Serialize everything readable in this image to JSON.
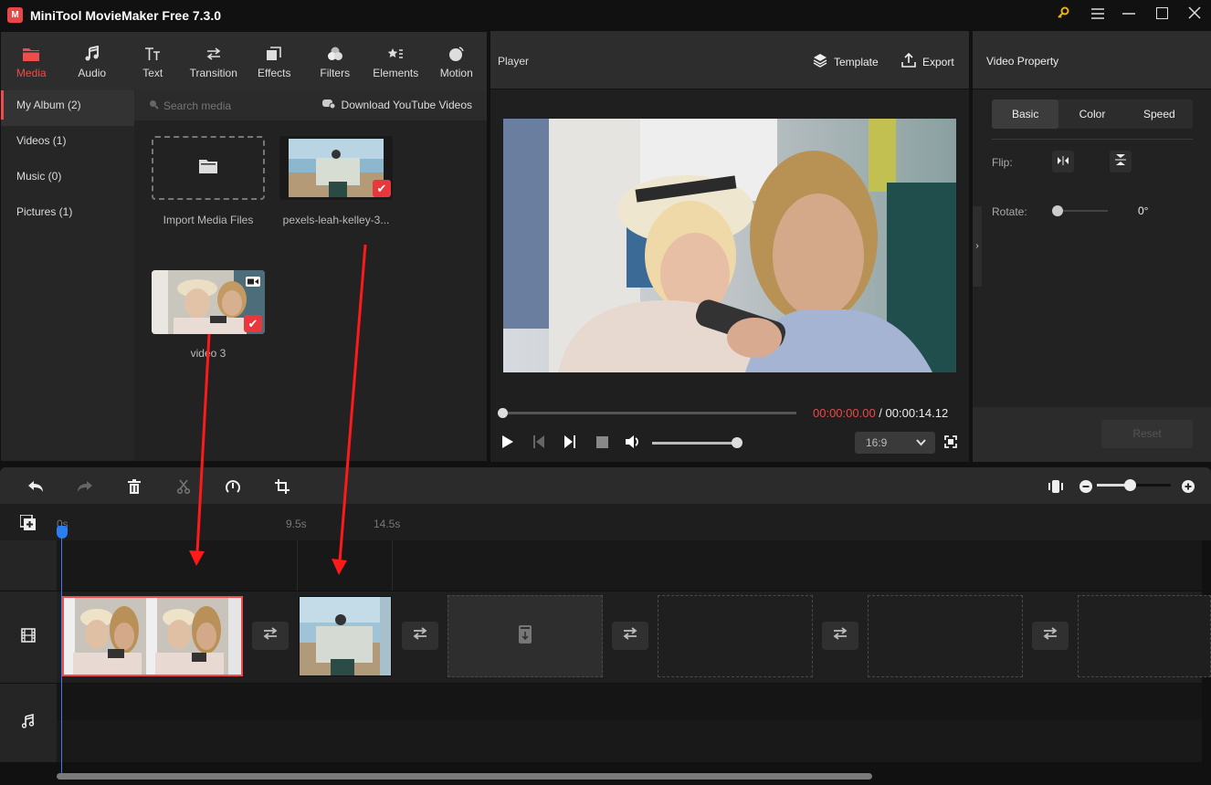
{
  "app": {
    "title": "MiniTool MovieMaker Free 7.3.0",
    "logo_glyph": "M",
    "window_controls": [
      {
        "name": "key-icon",
        "glyph": "🔑"
      },
      {
        "name": "menu-icon",
        "glyph": "☰"
      },
      {
        "name": "minimize-icon",
        "glyph": "—"
      },
      {
        "name": "maximize-icon",
        "glyph": "☐"
      },
      {
        "name": "close-icon",
        "glyph": "✕"
      }
    ]
  },
  "tool_tabs": [
    {
      "label": "Media",
      "icon": "folder-icon",
      "active": true
    },
    {
      "label": "Audio",
      "icon": "music-note-icon"
    },
    {
      "label": "Text",
      "icon": "text-icon"
    },
    {
      "label": "Transition",
      "icon": "transition-arrows-icon"
    },
    {
      "label": "Effects",
      "icon": "effects-icon"
    },
    {
      "label": "Filters",
      "icon": "filters-icon"
    },
    {
      "label": "Elements",
      "icon": "elements-icon"
    },
    {
      "label": "Motion",
      "icon": "motion-icon"
    }
  ],
  "album": {
    "items": [
      {
        "label": "My Album (2)",
        "active": true
      },
      {
        "label": "Videos (1)"
      },
      {
        "label": "Music (0)"
      },
      {
        "label": "Pictures (1)"
      }
    ]
  },
  "media": {
    "search_placeholder": "Search media",
    "youtube_label": "Download YouTube Videos",
    "import_label": "Import Media Files",
    "items": [
      {
        "label": "pexels-leah-kelley-3...",
        "type": "picture",
        "selected": true
      },
      {
        "label": "video 3",
        "type": "video",
        "selected": true
      }
    ]
  },
  "player": {
    "title": "Player",
    "template_label": "Template",
    "export_label": "Export",
    "time_current": "00:00:00.00",
    "time_separator": " / ",
    "time_total": "00:00:14.12",
    "progress": 0,
    "volume": 1.0,
    "aspect_ratio": "16:9"
  },
  "video_property": {
    "title": "Video Property",
    "tabs": [
      {
        "label": "Basic",
        "active": true
      },
      {
        "label": "Color"
      },
      {
        "label": "Speed"
      }
    ],
    "flip_label": "Flip:",
    "rotate_label": "Rotate:",
    "rotate_value": "0°",
    "reset_label": "Reset"
  },
  "timeline": {
    "ruler_labels": [
      "0s",
      "9.5s",
      "14.5s"
    ],
    "zoom_level": 0.45,
    "clips": [
      {
        "name": "video 3",
        "type": "video"
      },
      {
        "name": "pexels-leah-kelley",
        "type": "picture"
      }
    ],
    "empty_slot_count": 4
  },
  "colors": {
    "accent": "#ef4c4c",
    "playhead": "#2a7ef0",
    "time_current": "#e54b4b",
    "check_badge": "#e9383c"
  }
}
